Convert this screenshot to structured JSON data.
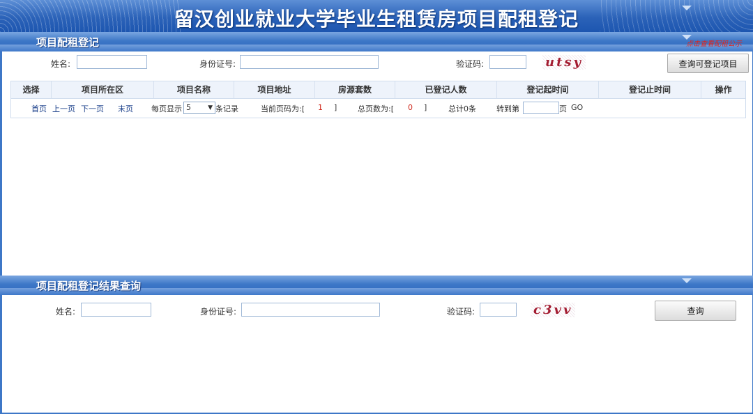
{
  "title": "留汉创业就业大学毕业生租赁房项目配租登记",
  "section1": {
    "title": "项目配租登记",
    "corner_link": "点击查看配租公示",
    "name_label": "姓名:",
    "id_label": "身份证号:",
    "captcha_label": "验证码:",
    "captcha_text": "utsy",
    "query_button": "查询可登记项目"
  },
  "table": {
    "columns": [
      "选择",
      "项目所在区",
      "项目名称",
      "项目地址",
      "房源套数",
      "已登记人数",
      "登记起时间",
      "登记止时间",
      "操作"
    ]
  },
  "pager": {
    "first": "首页",
    "prev": "上一页",
    "next": "下一页",
    "last": "末页",
    "per_page_prefix": "每页显示",
    "per_page_value": "5",
    "per_page_suffix": "条记录",
    "current_label": "当前页码为:[",
    "current_value": "1",
    "current_close": "]",
    "total_pages_label": "总页数为:[",
    "total_pages_value": "0",
    "total_pages_close": "]",
    "total_count": "总计0条",
    "goto_prefix": "转到第",
    "goto_suffix": "页",
    "go": "GO"
  },
  "section2": {
    "title": "项目配租登记结果查询",
    "name_label": "姓名:",
    "id_label": "身份证号:",
    "captcha_label": "验证码:",
    "captcha_text": "c3vv",
    "query_button": "查询"
  }
}
